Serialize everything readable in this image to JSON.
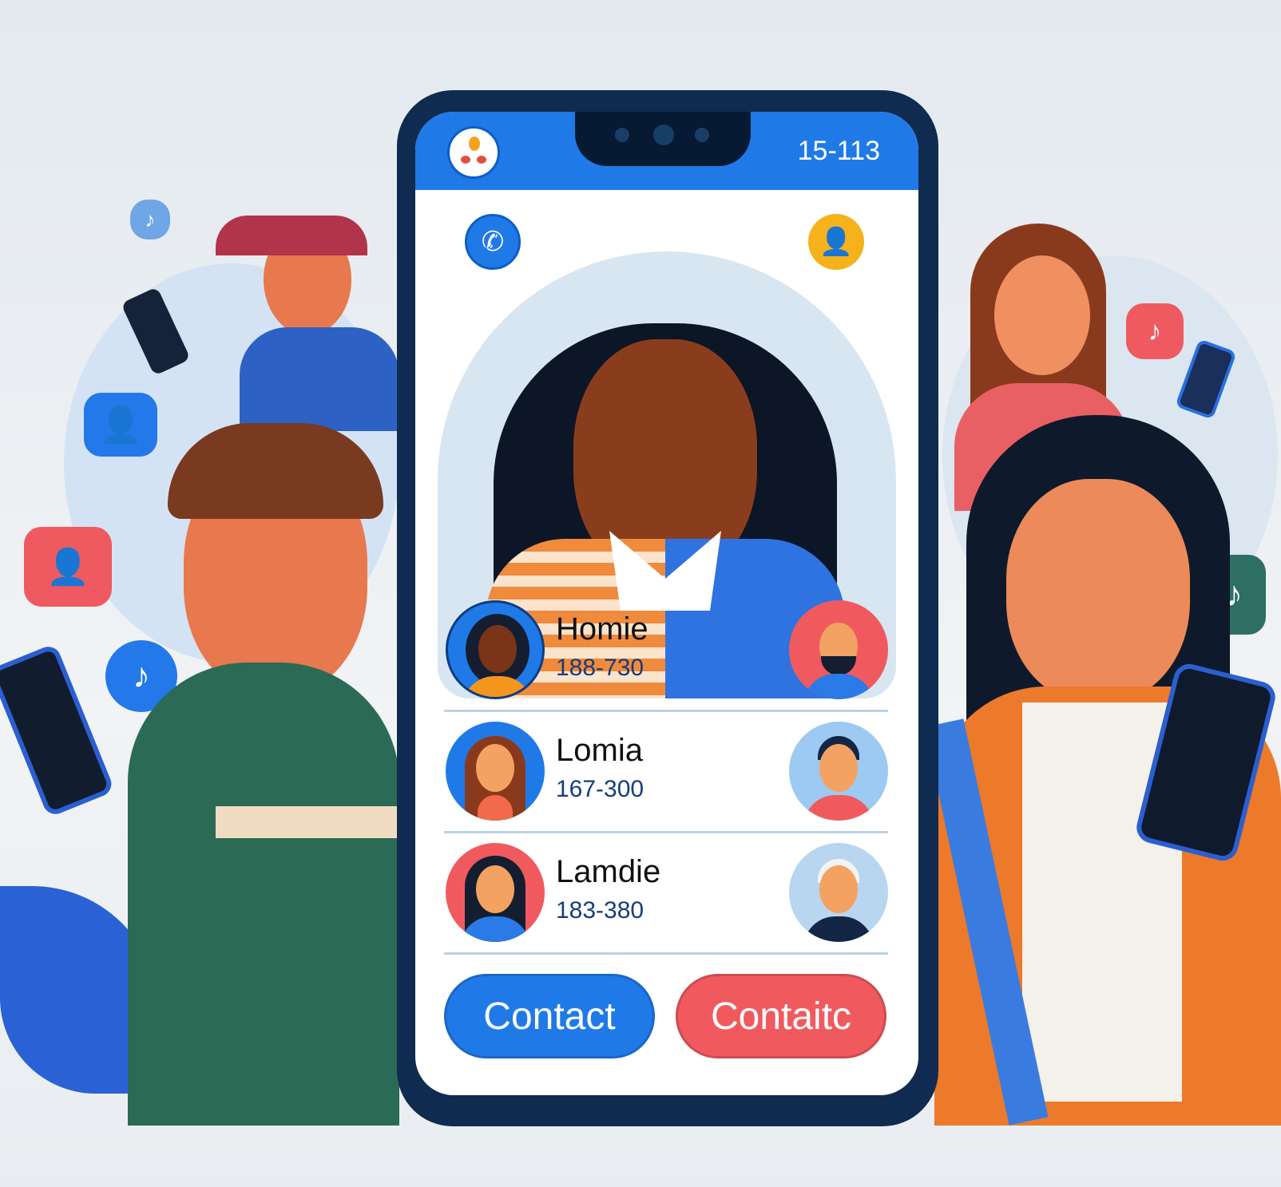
{
  "phone": {
    "status_time": "15-113",
    "hero_icons": {
      "left": "phone-icon",
      "right": "user-icon"
    },
    "contacts": [
      {
        "name": "Homie",
        "number": "188-730"
      },
      {
        "name": "Lomia",
        "number": "167-300"
      },
      {
        "name": "Lamdie",
        "number": "183-380"
      }
    ],
    "buttons": {
      "primary": "Contact",
      "secondary": "Contaitc"
    }
  },
  "colors": {
    "accent_blue": "#1f7ae8",
    "accent_red": "#f05a5f",
    "frame": "#0f2b4f",
    "yellow": "#f5b21c"
  }
}
